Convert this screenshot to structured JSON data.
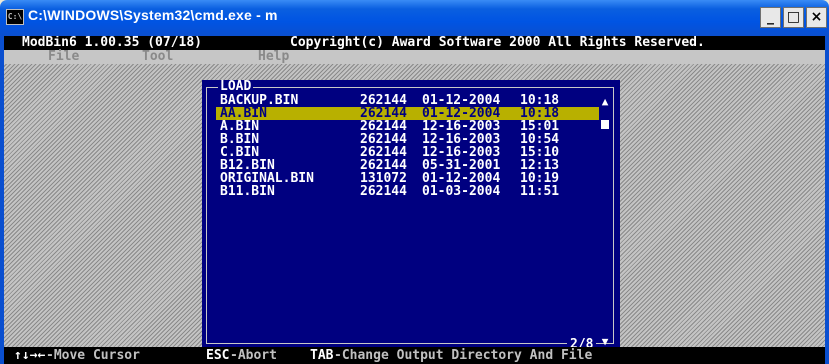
{
  "window": {
    "title": "C:\\WINDOWS\\System32\\cmd.exe - m",
    "system_icon": "console-icon",
    "buttons": {
      "minimize": "_",
      "maximize": "□",
      "close": "×"
    }
  },
  "app": {
    "name": "ModBin6 1.00.35 (07/18)",
    "copyright": "Copyright(c) Award Software 2000 All Rights Reserved."
  },
  "menu": {
    "file": "File",
    "tool": "Tool",
    "help": "Help"
  },
  "dialog": {
    "title": "LOAD",
    "pager": "2/8",
    "files": [
      {
        "name": "BACKUP.BIN",
        "size": "262144",
        "date": "01-12-2004",
        "time": "10:18"
      },
      {
        "name": "AA.BIN",
        "size": "262144",
        "date": "01-12-2004",
        "time": "10:18"
      },
      {
        "name": "A.BIN",
        "size": "262144",
        "date": "12-16-2003",
        "time": "15:01"
      },
      {
        "name": "B.BIN",
        "size": "262144",
        "date": "12-16-2003",
        "time": "10:54"
      },
      {
        "name": "C.BIN",
        "size": "262144",
        "date": "12-16-2003",
        "time": "15:10"
      },
      {
        "name": "B12.BIN",
        "size": "262144",
        "date": "05-31-2001",
        "time": "12:13"
      },
      {
        "name": "ORIGINAL.BIN",
        "size": "131072",
        "date": "01-12-2004",
        "time": "10:19"
      },
      {
        "name": "B11.BIN",
        "size": "262144",
        "date": "01-03-2004",
        "time": "11:51"
      }
    ],
    "selected_index": 1,
    "scroll": {
      "up": "▲",
      "down": "▼"
    }
  },
  "status": {
    "arrows_key": "↑↓→←",
    "arrows_text": "-Move Cursor",
    "esc_key": "ESC",
    "esc_text": "-Abort",
    "tab_key": "TAB",
    "tab_text": "-Change Output Directory And File"
  },
  "colors": {
    "titlebar": "#0054e3",
    "dialog_bg": "#000080",
    "selection": "#b8b000"
  }
}
